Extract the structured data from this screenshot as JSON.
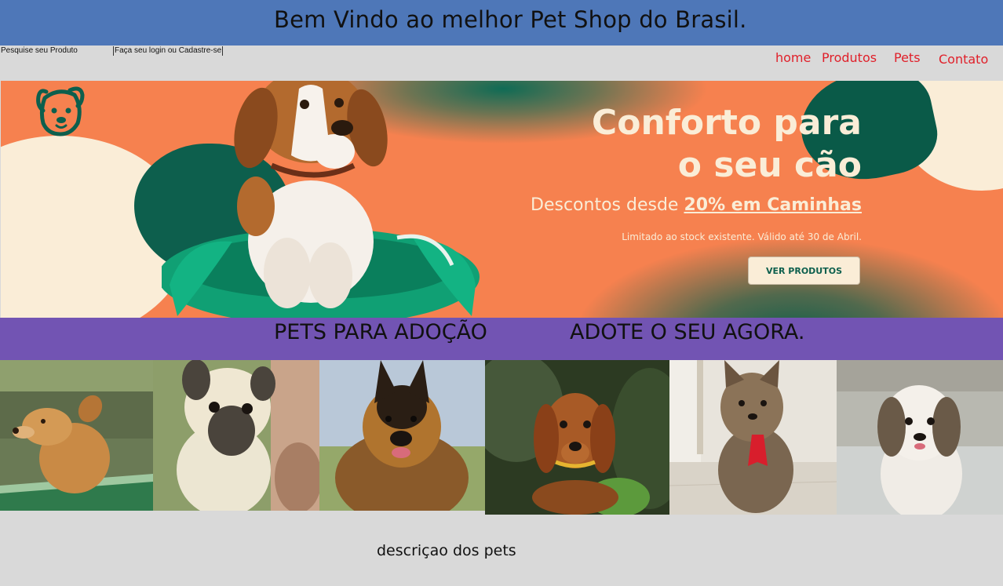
{
  "header": {
    "title": "Bem Vindo ao melhor Pet Shop do Brasil."
  },
  "nav": {
    "search_label": "Pesquise seu Produto",
    "login_label": "Faça seu login ou Cadastre-se",
    "links": [
      "home",
      "Produtos",
      "Pets",
      "Contato"
    ],
    "link_color": "#e0202a"
  },
  "hero": {
    "headline_line1": "Conforto para",
    "headline_line2": "o seu cão",
    "subline_prefix": "Descontos desde ",
    "subline_highlight": "20% em Caminhas",
    "note": "Limitado ao stock existente. Válido até 30 de Abril.",
    "button_label": "VER PRODUTOS",
    "colors": {
      "orange": "#f6814f",
      "green": "#0d5f4d",
      "cream": "#faedd7"
    }
  },
  "adoption": {
    "left_text": "PETS PARA ADOÇÃO",
    "right_text": "ADOTE O SEU AGORA.",
    "bar_color": "#7254b3"
  },
  "pets": [
    {
      "name": "dog-photo-mixed-breed"
    },
    {
      "name": "dog-photo-pug"
    },
    {
      "name": "dog-photo-german-shepherd"
    },
    {
      "name": "dog-photo-dachshund"
    },
    {
      "name": "dog-photo-yorkshire"
    },
    {
      "name": "dog-photo-shih-tzu"
    }
  ],
  "description": "descriçao dos pets",
  "colors": {
    "header_blue": "#4e77b8",
    "page_gray": "#d9d9d9"
  }
}
